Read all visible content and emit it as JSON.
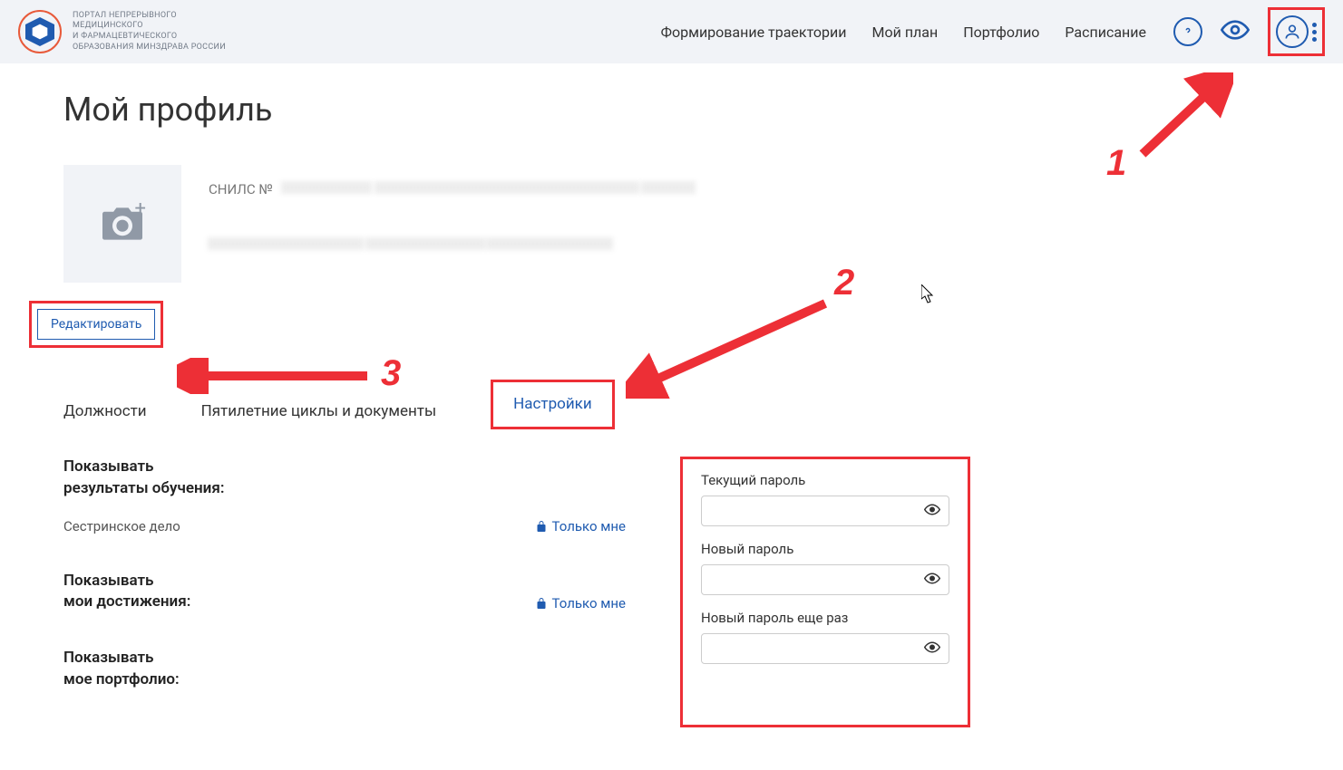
{
  "header": {
    "logo_text": "ПОРТАЛ НЕПРЕРЫВНОГО\nМЕДИЦИНСКОГО\nИ ФАРМАЦЕВТИЧЕСКОГО\nОБРАЗОВАНИЯ МИНЗДРАВА РОССИИ",
    "nav": {
      "trajectory": "Формирование траектории",
      "my_plan": "Мой план",
      "portfolio": "Портфолио",
      "schedule": "Расписание"
    }
  },
  "page_title": "Мой профиль",
  "profile": {
    "snils_label": "СНИЛС №",
    "edit_button": "Редактировать"
  },
  "tabs": {
    "positions": "Должности",
    "cycles": "Пятилетние циклы и документы",
    "settings": "Настройки"
  },
  "settings_left": {
    "show_results_label": "Показывать\nрезультаты обучения:",
    "nursing": "Сестринское дело",
    "only_me_1": "Только мне",
    "show_achievements_label": "Показывать\nмои достижения:",
    "only_me_2": "Только мне",
    "show_portfolio_label": "Показывать\nмое портфолио:"
  },
  "password_panel": {
    "current_label": "Текущий пароль",
    "new_label": "Новый пароль",
    "repeat_label": "Новый пароль еще раз"
  },
  "annotations": {
    "num1": "1",
    "num2": "2",
    "num3": "3"
  }
}
